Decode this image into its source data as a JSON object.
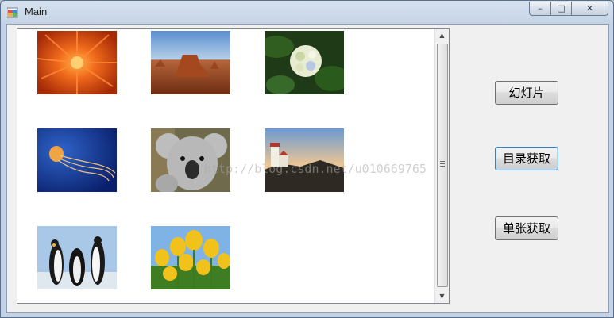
{
  "window": {
    "title": "Main",
    "controls": {
      "minimize": "–",
      "maximize": "□",
      "close": "✕"
    }
  },
  "listview": {
    "items": [
      {
        "icon": "chrysanthemum-image"
      },
      {
        "icon": "desert-image"
      },
      {
        "icon": "hydrangeas-image"
      },
      {
        "icon": "jellyfish-image"
      },
      {
        "icon": "koala-image"
      },
      {
        "icon": "lighthouse-image"
      },
      {
        "icon": "penguins-image"
      },
      {
        "icon": "tulips-image"
      }
    ],
    "scroll_up": "▲",
    "scroll_down": "▼"
  },
  "buttons": {
    "slideshow": "幻灯片",
    "directory_fetch": "目录获取",
    "single_fetch": "单张获取"
  },
  "watermark": "http://blog.csdn.net/u010669765"
}
